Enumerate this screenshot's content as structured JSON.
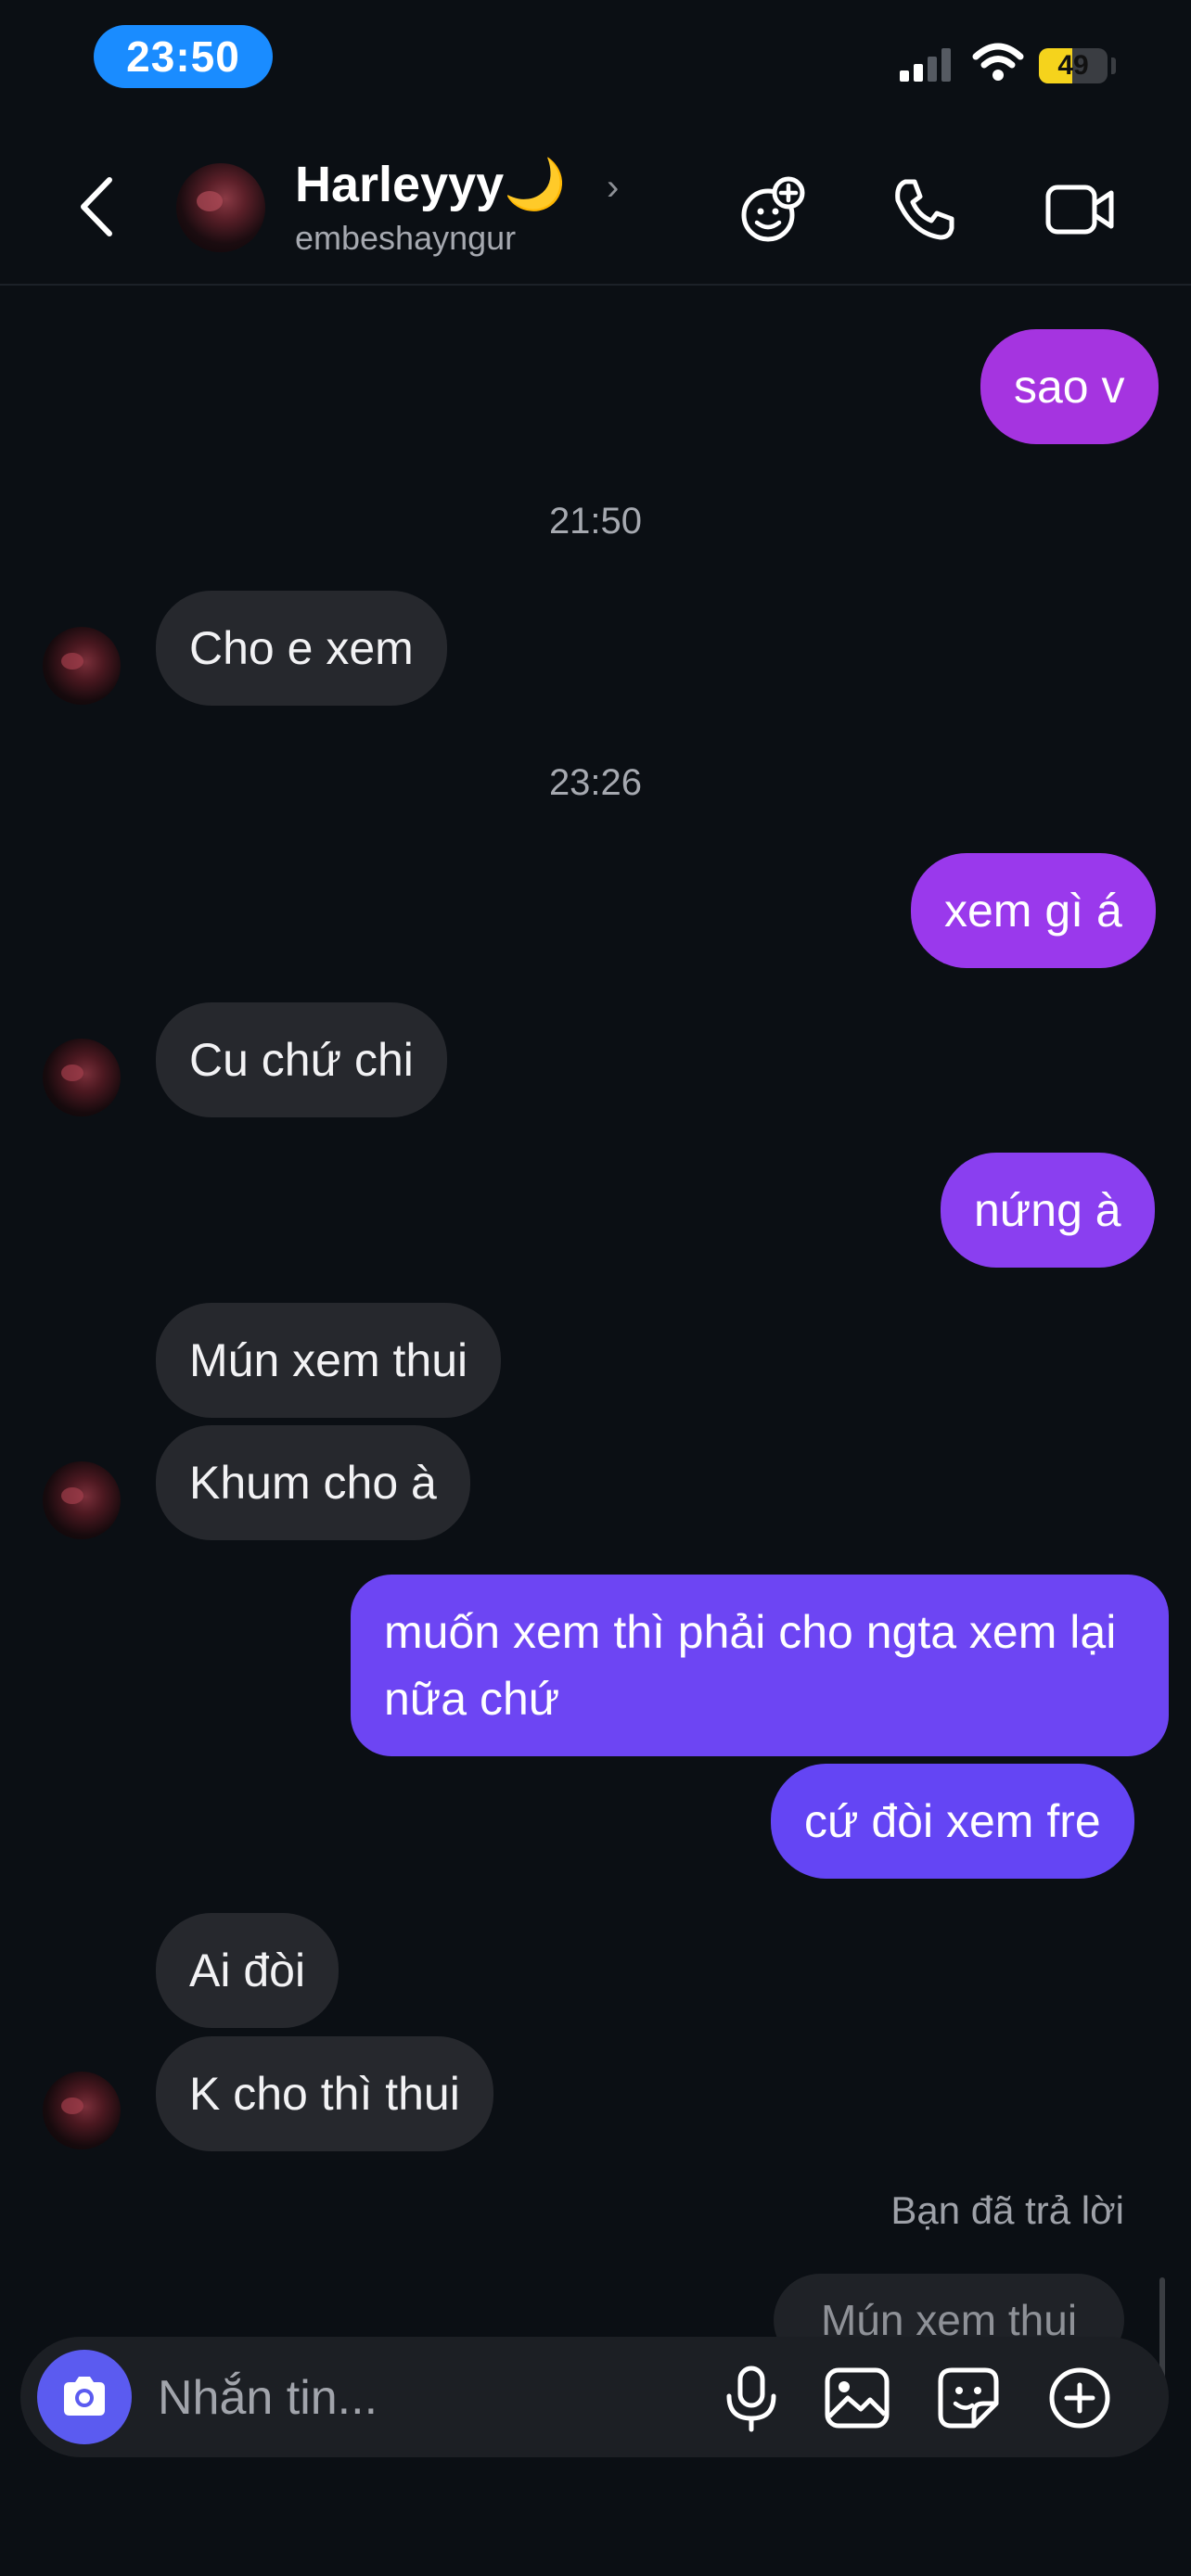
{
  "status_bar": {
    "time": "23:50",
    "battery": "49"
  },
  "header": {
    "contact_name": "Harleyyy🌙",
    "username": "embeshayngur",
    "chevron": "›"
  },
  "messages": [
    {
      "type": "sent",
      "text": "sao v"
    },
    {
      "type": "timestamp",
      "text": "21:50"
    },
    {
      "type": "received",
      "text": "Cho e xem"
    },
    {
      "type": "timestamp",
      "text": "23:26"
    },
    {
      "type": "sent",
      "text": "xem gì á"
    },
    {
      "type": "received",
      "text": "Cu chứ chi"
    },
    {
      "type": "sent",
      "text": "nứng à"
    },
    {
      "type": "received",
      "text": "Mún xem thui"
    },
    {
      "type": "received",
      "text": "Khum cho à"
    },
    {
      "type": "sent",
      "text": "muốn xem thì phải cho ngta xem lại nữa chứ"
    },
    {
      "type": "sent",
      "text": "cứ đòi xem fre"
    },
    {
      "type": "received",
      "text": "Ai đòi"
    },
    {
      "type": "received",
      "text": "K cho thì thui"
    }
  ],
  "reply": {
    "label": "Bạn đã trả lời",
    "quoted": "Mún xem thui"
  },
  "composer": {
    "placeholder": "Nhắn tin..."
  },
  "icons": {
    "back": "chevron-left-icon",
    "game": "game-smiley-icon",
    "call": "phone-icon",
    "video": "video-camera-icon",
    "camera": "camera-icon",
    "mic": "microphone-icon",
    "gallery": "image-icon",
    "sticker": "sticker-icon",
    "more": "plus-circle-icon"
  },
  "colors": {
    "background": "#0b0f14",
    "received_bubble": "#26282d",
    "sent_gradient_top": "#a534e0",
    "sent_gradient_bottom": "#5b44f5",
    "camera_button": "#5b5bf0",
    "time_pill": "#1a8cff",
    "battery": "#f5d31c"
  }
}
